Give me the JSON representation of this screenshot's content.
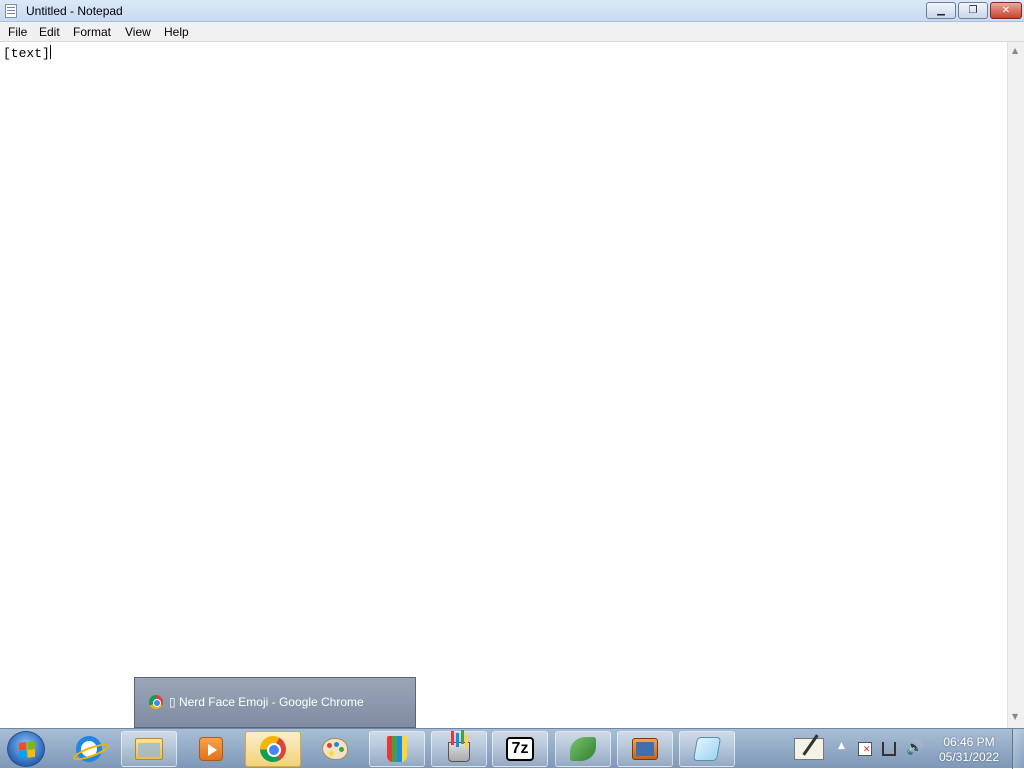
{
  "window": {
    "title": "Untitled - Notepad",
    "buttons": {
      "minimize": "▁",
      "maximize": "❐",
      "close": "✕"
    }
  },
  "menu": [
    "File",
    "Edit",
    "Format",
    "View",
    "Help"
  ],
  "editor": {
    "content": "[text]"
  },
  "scrollbar": {
    "up": "▲",
    "down": "▼"
  },
  "chrome_popup": {
    "label": "▯ Nerd Face Emoji - Google Chrome"
  },
  "taskbar": {
    "items": [
      {
        "name": "Internet Explorer",
        "icon": "ie-icon",
        "state": "pinned"
      },
      {
        "name": "Windows Explorer",
        "icon": "folder-icon",
        "state": "running"
      },
      {
        "name": "Windows Media Player",
        "icon": "media-player-icon",
        "state": "pinned"
      },
      {
        "name": "Google Chrome",
        "icon": "chrome-icon",
        "state": "active"
      },
      {
        "name": "Paint",
        "icon": "paint-icon",
        "state": "pinned"
      },
      {
        "name": "Drawing app",
        "icon": "pencils-icon",
        "state": "running"
      },
      {
        "name": "Pencil cup app",
        "icon": "pencil-cup-icon",
        "state": "running"
      },
      {
        "name": "7-Zip",
        "icon": "7zip-icon",
        "state": "running"
      },
      {
        "name": "App",
        "icon": "leaf-icon",
        "state": "running"
      },
      {
        "name": "Movie Maker",
        "icon": "movie-maker-icon",
        "state": "running"
      },
      {
        "name": "Notepad",
        "icon": "notepad-icon",
        "state": "running"
      }
    ],
    "seven_zip_label": "7z"
  },
  "tray": {
    "time": "06:46 PM",
    "date": "05/31/2022",
    "show_hidden": "▲",
    "volume": "🔊"
  }
}
